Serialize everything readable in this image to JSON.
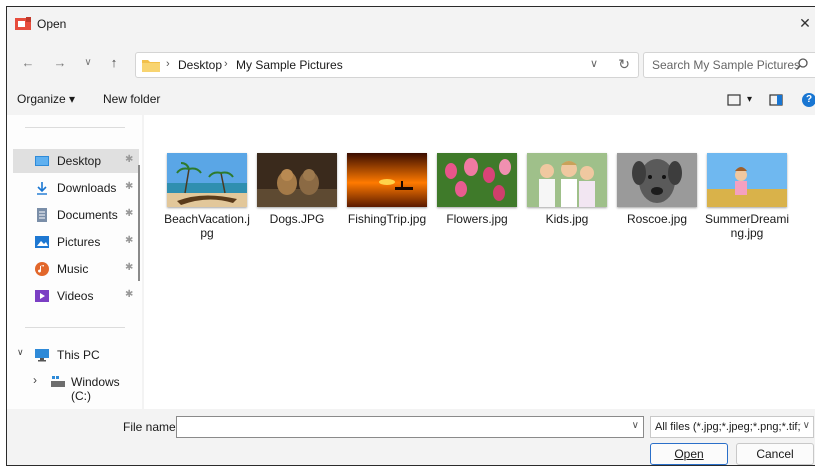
{
  "window": {
    "title": "Open",
    "close_glyph": "✕"
  },
  "nav": {
    "back_glyph": "←",
    "forward_glyph": "→",
    "recent_glyph": "∨",
    "up_glyph": "↑",
    "breadcrumb": [
      "Desktop",
      "My Sample Pictures"
    ],
    "separator": "›",
    "address_dropdown_glyph": "∨",
    "refresh_glyph": "↻",
    "search_placeholder": "Search My Sample Pictures"
  },
  "toolbar": {
    "organize": "Organize ▾",
    "new_folder": "New folder",
    "view_dropdown": "▾",
    "help": "?"
  },
  "sidebar": {
    "quick_access": [
      {
        "label": "Desktop",
        "icon": "desktop-icon",
        "selected": true
      },
      {
        "label": "Downloads",
        "icon": "download-icon"
      },
      {
        "label": "Documents",
        "icon": "documents-icon"
      },
      {
        "label": "Pictures",
        "icon": "pictures-icon"
      },
      {
        "label": "Music",
        "icon": "music-icon"
      },
      {
        "label": "Videos",
        "icon": "videos-icon"
      }
    ],
    "pin_glyph": "✱",
    "this_pc": {
      "label": "This PC",
      "expand": "∨"
    },
    "windows_c": {
      "label": "Windows (C:)",
      "expand": "›"
    }
  },
  "files": [
    {
      "name": "BeachVacation.jpg",
      "thumb": "beach"
    },
    {
      "name": "Dogs.JPG",
      "thumb": "dogs"
    },
    {
      "name": "FishingTrip.jpg",
      "thumb": "sunset"
    },
    {
      "name": "Flowers.jpg",
      "thumb": "flowers"
    },
    {
      "name": "Kids.jpg",
      "thumb": "kids"
    },
    {
      "name": "Roscoe.jpg",
      "thumb": "roscoe"
    },
    {
      "name": "SummerDreaming.jpg",
      "thumb": "summer"
    }
  ],
  "bottom": {
    "file_name_label": "File name:",
    "file_name_value": "",
    "dropdown_glyph": "∨",
    "filter": "All files (*.jpg;*.jpeg;*.png;*.tif;*",
    "open_button": "Open",
    "cancel_button": "Cancel"
  },
  "colors": {
    "accent": "#1976d2",
    "folder": "#f2c04a",
    "selected": "#e0e0e0"
  }
}
